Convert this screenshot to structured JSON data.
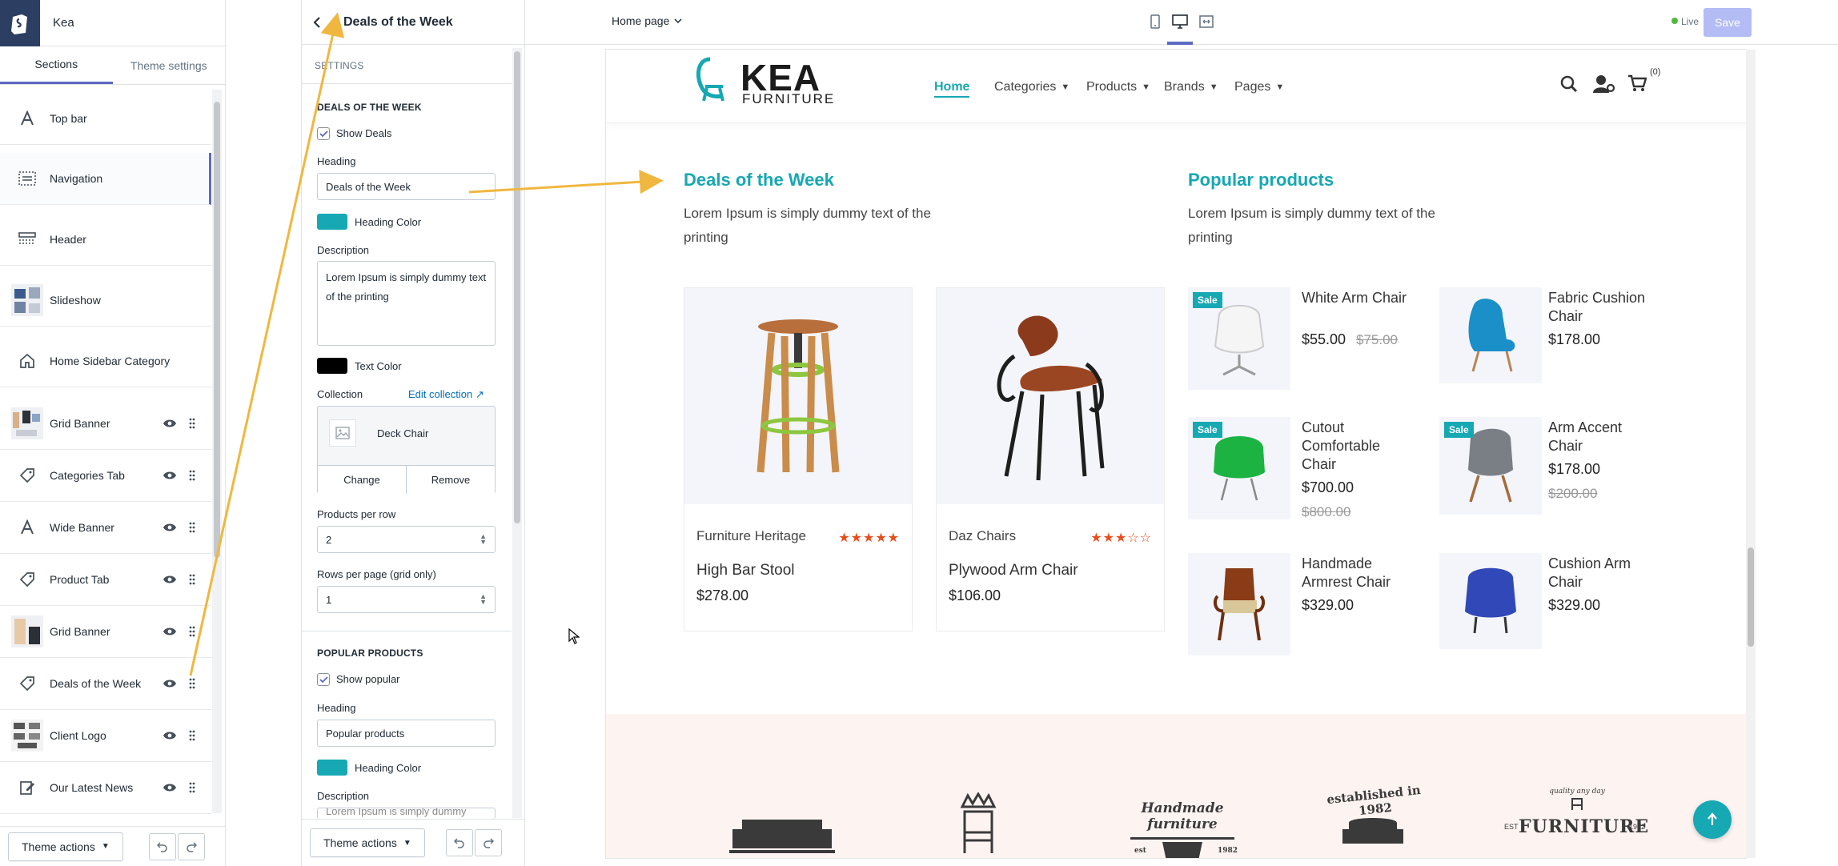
{
  "left_panel": {
    "store_name": "Kea",
    "tabs": [
      "Sections",
      "Theme settings"
    ],
    "sections": [
      {
        "label": "Top bar"
      },
      {
        "label": "Navigation"
      },
      {
        "label": "Header"
      },
      {
        "label": "Slideshow"
      },
      {
        "label": "Home Sidebar Category"
      },
      {
        "label": "Grid Banner"
      },
      {
        "label": "Categories Tab"
      },
      {
        "label": "Wide Banner"
      },
      {
        "label": "Product Tab"
      },
      {
        "label": "Grid Banner"
      },
      {
        "label": "Deals of the Week"
      },
      {
        "label": "Client Logo"
      },
      {
        "label": "Our Latest News"
      }
    ],
    "footer": {
      "theme_actions": "Theme actions"
    }
  },
  "settings_panel": {
    "title": "Deals of the Week",
    "settings_label": "SETTINGS",
    "deals": {
      "group_title": "DEALS OF THE WEEK",
      "show_label": "Show Deals",
      "heading_label": "Heading",
      "heading_value": "Deals of the Week",
      "heading_color_label": "Heading Color",
      "heading_color": "#16a8b3",
      "description_label": "Description",
      "description_value": "Lorem Ipsum is simply dummy text of the printing",
      "text_color_label": "Text Color",
      "text_color": "#000000",
      "collection_label": "Collection",
      "edit_collection": "Edit collection",
      "collection_value": "Deck Chair",
      "change": "Change",
      "remove": "Remove",
      "products_per_row_label": "Products per row",
      "products_per_row": "2",
      "rows_per_page_label": "Rows per page (grid only)",
      "rows_per_page": "1"
    },
    "popular": {
      "group_title": "POPULAR PRODUCTS",
      "show_label": "Show popular",
      "heading_label": "Heading",
      "heading_value": "Popular products",
      "heading_color_label": "Heading Color",
      "description_label": "Description",
      "description_partial": "Lorem Ipsum is simply dummy"
    },
    "footer": {
      "theme_actions": "Theme actions"
    }
  },
  "topbar": {
    "page_select": "Home page",
    "status": "Live",
    "save": "Save"
  },
  "preview": {
    "logo_main": "KEA",
    "logo_sub": "FURNITURE",
    "nav": [
      "Home",
      "Categories",
      "Products",
      "Brands",
      "Pages"
    ],
    "cart_count": "(0)",
    "deals": {
      "heading": "Deals of the Week",
      "description": "Lorem Ipsum is simply dummy text of the printing",
      "products": [
        {
          "brand": "Furniture Heritage",
          "name": "High Bar Stool",
          "price": "$278.00",
          "rating": 5
        },
        {
          "brand": "Daz Chairs",
          "name": "Plywood Arm Chair",
          "price": "$106.00",
          "rating": 3
        }
      ]
    },
    "popular": {
      "heading": "Popular products",
      "description": "Lorem Ipsum is simply dummy text of the printing",
      "sale_badge": "Sale",
      "products": [
        {
          "name": "White Arm Chair",
          "price": "$55.00",
          "old_price": "$75.00"
        },
        {
          "name": "Fabric Cushion Chair",
          "price": "$178.00"
        },
        {
          "name": "Cutout Comfortable Chair",
          "price": "$700.00",
          "old_price": "$800.00"
        },
        {
          "name": "Arm Accent Chair",
          "price": "$178.00",
          "old_price": "$200.00"
        },
        {
          "name": "Handmade Armrest Chair",
          "price": "$329.00"
        },
        {
          "name": "Cushion Arm Chair",
          "price": "$329.00"
        }
      ]
    },
    "client_logos": {
      "logo3": "Handmade furniture",
      "logo4": "established in 1982",
      "logo5_top": "quality any day",
      "logo5": "FURNITURE",
      "logo5_est": "EST",
      "logo5_year": "1982",
      "logo3_est": "est",
      "logo3_year": "1982"
    }
  },
  "colors": {
    "accent": "#16a8b3",
    "annotation_arrow": "#f0b73f",
    "admin_accent": "#5c6ac4",
    "live": "#50b83c"
  }
}
